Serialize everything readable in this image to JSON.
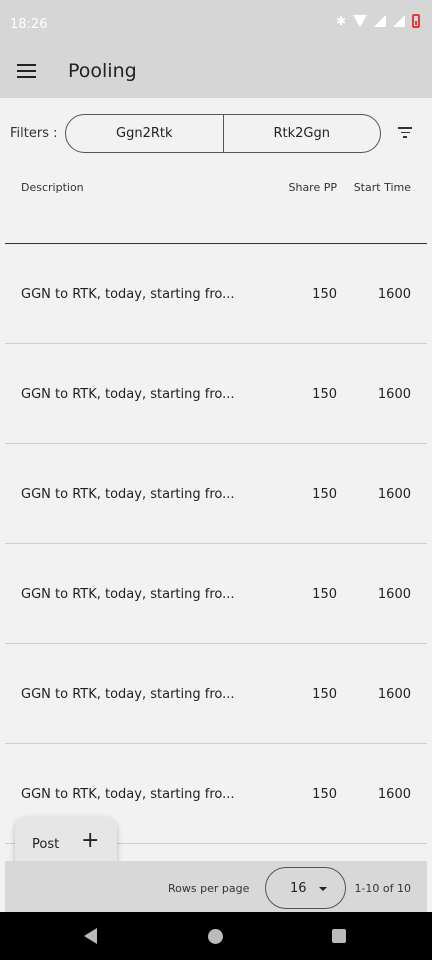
{
  "status_bar": {
    "time": "18:26"
  },
  "app_bar": {
    "title": "Pooling"
  },
  "filters": {
    "label": "Filters :",
    "options": [
      "Ggn2Rtk",
      "Rtk2Ggn"
    ]
  },
  "table": {
    "columns": [
      "Description",
      "Share PP",
      "Start Time"
    ],
    "rows": [
      {
        "description": "GGN to RTK, today, starting fro...",
        "share_pp": "150",
        "start_time": "1600"
      },
      {
        "description": "GGN to RTK, today, starting fro...",
        "share_pp": "150",
        "start_time": "1600"
      },
      {
        "description": "GGN to RTK, today, starting fro...",
        "share_pp": "150",
        "start_time": "1600"
      },
      {
        "description": "GGN to RTK, today, starting fro...",
        "share_pp": "150",
        "start_time": "1600"
      },
      {
        "description": "GGN to RTK, today, starting fro...",
        "share_pp": "150",
        "start_time": "1600"
      },
      {
        "description": "GGN to RTK, today, starting fro...",
        "share_pp": "150",
        "start_time": "1600"
      }
    ]
  },
  "fab": {
    "label": "Post",
    "icon": "+"
  },
  "pagination": {
    "rows_per_page_label": "Rows per page",
    "rows_per_page": "16",
    "range": "1-10 of 10"
  },
  "icons": [
    "menu-icon",
    "filter-icon",
    "plus-icon",
    "caret-down-icon",
    "back-icon",
    "home-icon",
    "recents-icon",
    "bluetooth-icon",
    "wifi-icon",
    "signal-icon",
    "battery-icon"
  ]
}
